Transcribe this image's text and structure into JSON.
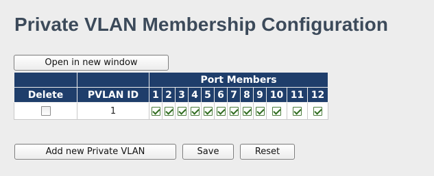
{
  "page": {
    "title": "Private VLAN Membership Configuration"
  },
  "buttons": {
    "open_new_window": "Open in new window",
    "add_new_pvlan": "Add new Private VLAN",
    "save": "Save",
    "reset": "Reset"
  },
  "table": {
    "group_header": "Port Members",
    "headers": {
      "delete": "Delete",
      "pvlan_id": "PVLAN ID"
    },
    "ports": [
      "1",
      "2",
      "3",
      "4",
      "5",
      "6",
      "7",
      "8",
      "9",
      "10",
      "11",
      "12"
    ],
    "rows": [
      {
        "delete": false,
        "pvlan_id": "1",
        "members": [
          true,
          true,
          true,
          true,
          true,
          true,
          true,
          true,
          true,
          true,
          true,
          true
        ]
      }
    ]
  },
  "colors": {
    "header_bg": "#1f3e6b",
    "title": "#3c4a5a",
    "page_bg": "#ededed"
  }
}
